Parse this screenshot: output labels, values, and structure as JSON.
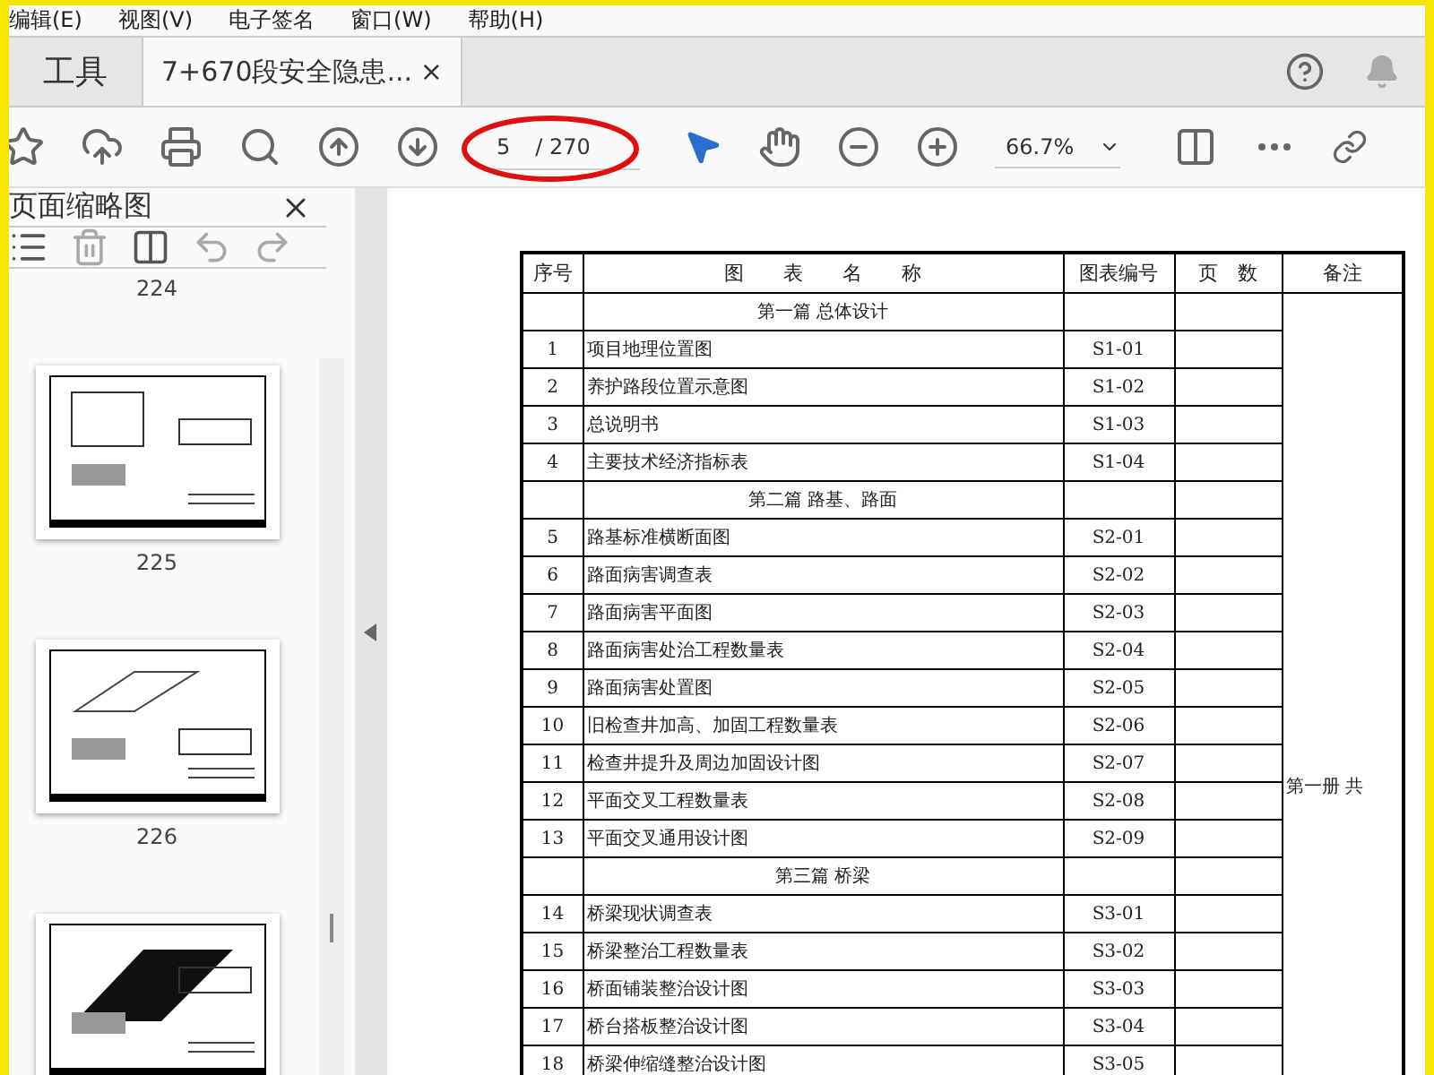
{
  "menu": [
    "编辑(E)",
    "视图(V)",
    "电子签名",
    "窗口(W)",
    "帮助(H)"
  ],
  "tabs": [
    {
      "label": "工具",
      "kind": "home",
      "selected": false
    },
    {
      "label": "7+670段安全隐患...",
      "kind": "document",
      "selected": true,
      "close": "×"
    }
  ],
  "toolbar": {
    "page_current": "5",
    "page_total": "/ 270",
    "zoom": "66.7%"
  },
  "panel": {
    "title": "页面缩略图",
    "pages": [
      {
        "label": "224"
      },
      {
        "label": "225"
      },
      {
        "label": "226"
      }
    ]
  },
  "table": {
    "columns": [
      "序号",
      "图　　表　　名　　称",
      "图表编号",
      "页　数",
      "备注"
    ],
    "remark": "第一册 共",
    "rows": [
      {
        "kind": "section",
        "name": "第一篇 总体设计"
      },
      {
        "kind": "item",
        "no": "1",
        "name": "项目地理位置图",
        "code": "S1-01"
      },
      {
        "kind": "item",
        "no": "2",
        "name": "养护路段位置示意图",
        "code": "S1-02"
      },
      {
        "kind": "item",
        "no": "3",
        "name": "总说明书",
        "code": "S1-03"
      },
      {
        "kind": "item",
        "no": "4",
        "name": "主要技术经济指标表",
        "code": "S1-04"
      },
      {
        "kind": "section",
        "name": "第二篇 路基、路面"
      },
      {
        "kind": "item",
        "no": "5",
        "name": "路基标准横断面图",
        "code": "S2-01"
      },
      {
        "kind": "item",
        "no": "6",
        "name": "路面病害调查表",
        "code": "S2-02"
      },
      {
        "kind": "item",
        "no": "7",
        "name": "路面病害平面图",
        "code": "S2-03"
      },
      {
        "kind": "item",
        "no": "8",
        "name": "路面病害处治工程数量表",
        "code": "S2-04"
      },
      {
        "kind": "item",
        "no": "9",
        "name": "路面病害处置图",
        "code": "S2-05"
      },
      {
        "kind": "item",
        "no": "10",
        "name": "旧检查井加高、加固工程数量表",
        "code": "S2-06"
      },
      {
        "kind": "item",
        "no": "11",
        "name": "检查井提升及周边加固设计图",
        "code": "S2-07"
      },
      {
        "kind": "item",
        "no": "12",
        "name": "平面交叉工程数量表",
        "code": "S2-08"
      },
      {
        "kind": "item",
        "no": "13",
        "name": "平面交叉通用设计图",
        "code": "S2-09"
      },
      {
        "kind": "section",
        "name": "第三篇 桥梁"
      },
      {
        "kind": "item",
        "no": "14",
        "name": "桥梁现状调查表",
        "code": "S3-01"
      },
      {
        "kind": "item",
        "no": "15",
        "name": "桥梁整治工程数量表",
        "code": "S3-02"
      },
      {
        "kind": "item",
        "no": "16",
        "name": "桥面铺装整治设计图",
        "code": "S3-03"
      },
      {
        "kind": "item",
        "no": "17",
        "name": "桥台搭板整治设计图",
        "code": "S3-04"
      },
      {
        "kind": "item",
        "no": "18",
        "name": "桥梁伸缩缝整治设计图",
        "code": "S3-05"
      }
    ]
  }
}
